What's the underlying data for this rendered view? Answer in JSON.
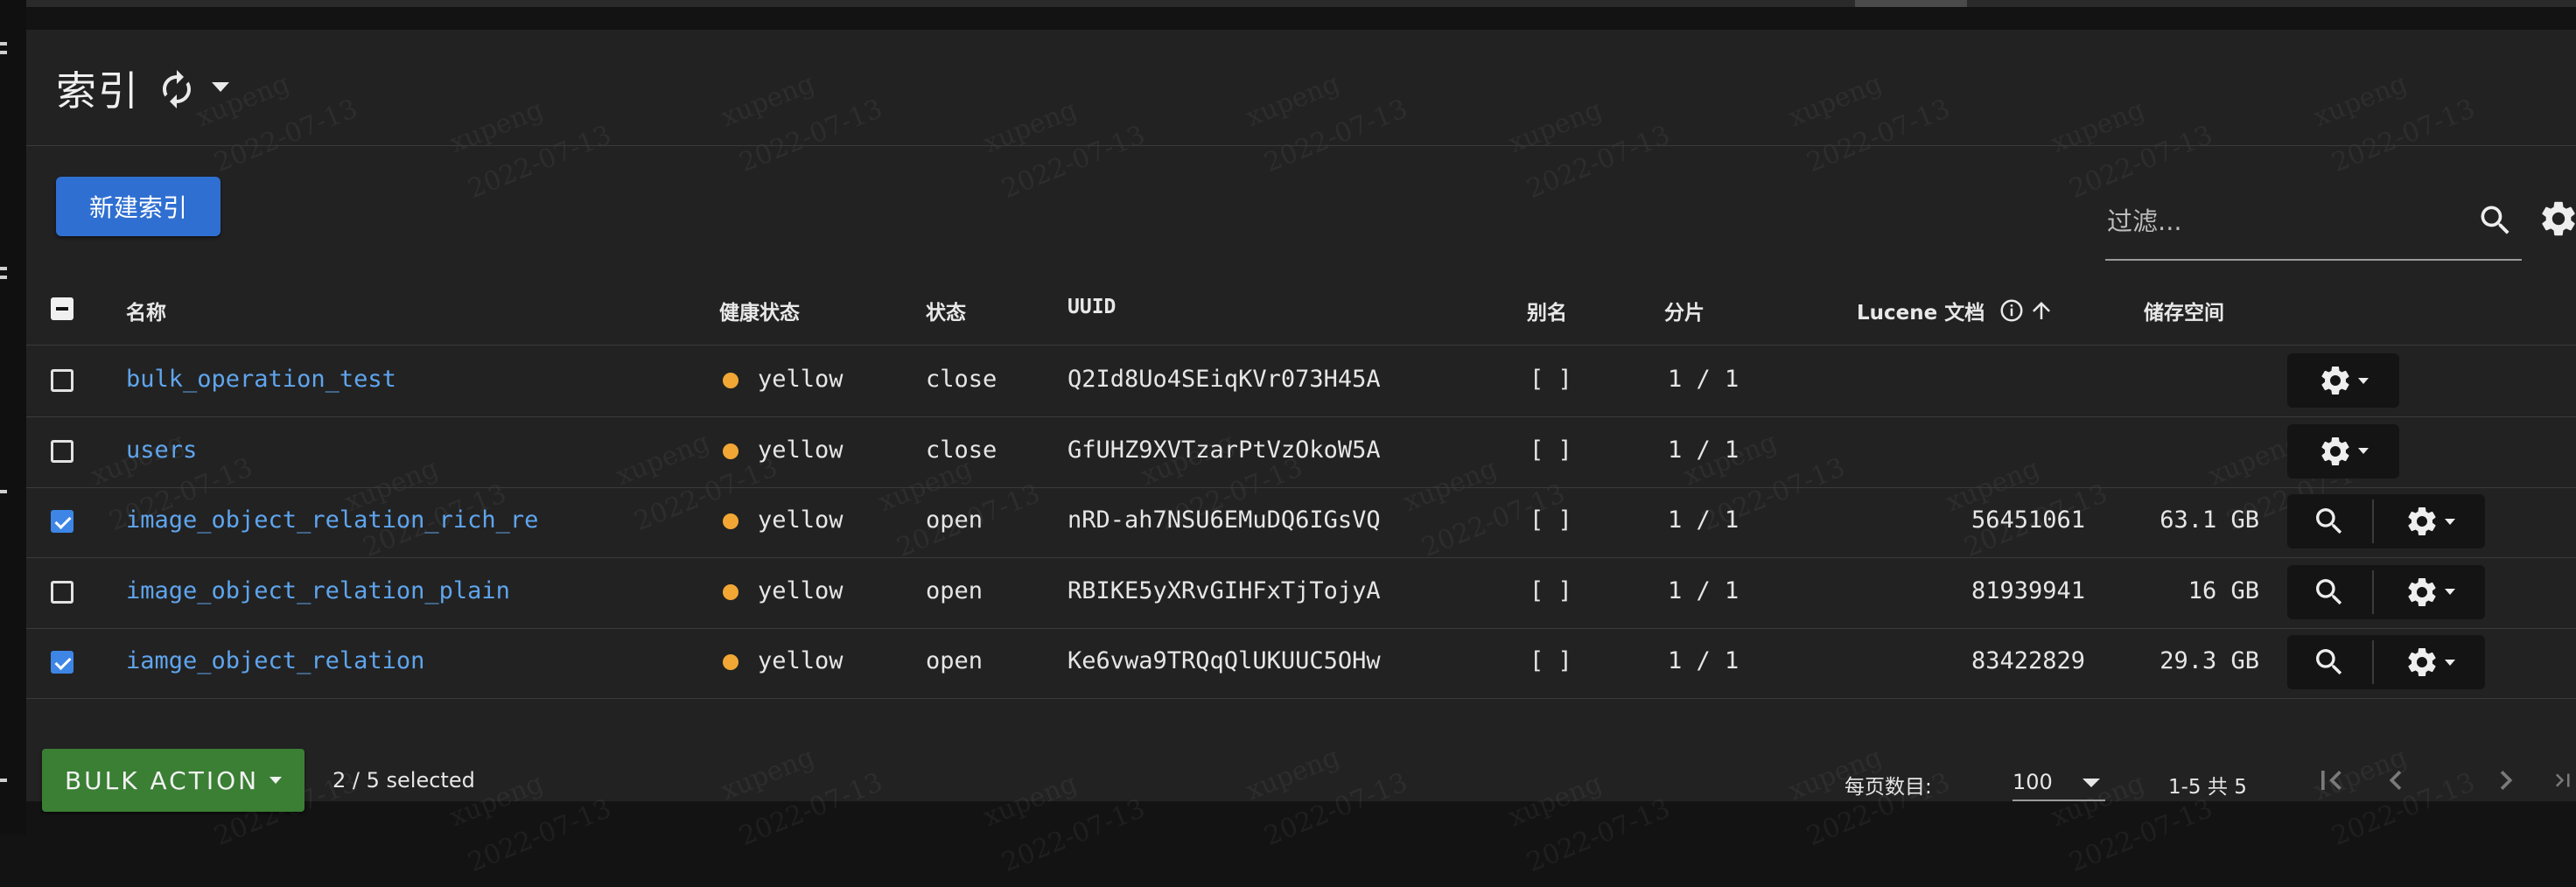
{
  "page": {
    "title": "索引",
    "new_index_label": "新建索引",
    "filter_placeholder": "过滤..."
  },
  "watermark": {
    "name": "xupeng",
    "date": "2022-07-13"
  },
  "table": {
    "headers": {
      "name": "名称",
      "health": "健康状态",
      "status": "状态",
      "uuid": "UUID",
      "alias": "别名",
      "shards": "分片",
      "docs": "Lucene 文档",
      "storage": "储存空间"
    },
    "rows": [
      {
        "checked": false,
        "name": "bulk_operation_test",
        "health": "yellow",
        "status": "close",
        "uuid": "Q2Id8Uo4SEiqKVr073H45A",
        "alias": "[ ]",
        "shards": "1 / 1",
        "docs": "",
        "storage": ""
      },
      {
        "checked": false,
        "name": "users",
        "health": "yellow",
        "status": "close",
        "uuid": "GfUHZ9XVTzarPtVzOkoW5A",
        "alias": "[ ]",
        "shards": "1 / 1",
        "docs": "",
        "storage": ""
      },
      {
        "checked": true,
        "name": "image_object_relation_rich_re",
        "health": "yellow",
        "status": "open",
        "uuid": "nRD-ah7NSU6EMuDQ6IGsVQ",
        "alias": "[ ]",
        "shards": "1 / 1",
        "docs": "56451061",
        "storage": "63.1 GB"
      },
      {
        "checked": false,
        "name": "image_object_relation_plain",
        "health": "yellow",
        "status": "open",
        "uuid": "RBIKE5yXRvGIHFxTjTojyA",
        "alias": "[ ]",
        "shards": "1 / 1",
        "docs": "81939941",
        "storage": "16 GB"
      },
      {
        "checked": true,
        "name": "iamge_object_relation",
        "health": "yellow",
        "status": "open",
        "uuid": "Ke6vwa9TRQqQlUKUUC5OHw",
        "alias": "[ ]",
        "shards": "1 / 1",
        "docs": "83422829",
        "storage": "29.3 GB"
      }
    ]
  },
  "footer": {
    "bulk_label": "BULK ACTION",
    "selected_text": "2 / 5 selected",
    "per_page_label": "每页数目:",
    "per_page_value": "100",
    "range_text": "1-5 共 5"
  },
  "colors": {
    "primary_button": "#2f6fd1",
    "bulk_button": "#3a7f34",
    "link": "#5fa5ee",
    "health_yellow": "#f2a735",
    "checkbox_checked": "#3d86e6"
  },
  "icons": {
    "refresh": "refresh-icon",
    "search": "search-icon",
    "settings": "gear-icon",
    "info": "info-icon",
    "sort": "arrow-up-icon",
    "first_page": "first-page-icon",
    "prev_page": "chevron-left-icon",
    "next_page": "chevron-right-icon",
    "last_page": "last-page-icon"
  }
}
